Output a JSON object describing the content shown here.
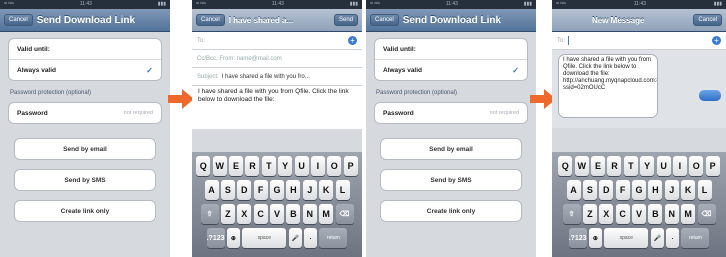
{
  "colors": {
    "accent": "#3a7bd5",
    "arrow": "#ef6a2a",
    "nav": "#5c7ea6"
  },
  "status": {
    "carrier": "ᵃᵗ ᵗᵉˡᵉ",
    "time": "11:43",
    "battery": "▮▮▮"
  },
  "screen1": {
    "nav_btn": "Cancel",
    "title": "Send Download Link",
    "rows": [
      {
        "label": "Valid until:"
      },
      {
        "label": "Always valid"
      }
    ],
    "section": "Password protection (optional)",
    "password": {
      "label": "Password",
      "placeholder": "not required"
    },
    "buttons": [
      "Send by email",
      "Send by SMS",
      "Create link only"
    ]
  },
  "screen2": {
    "nav_btn": "Cancel",
    "title": "I have shared a...",
    "nav_right": "Send",
    "to": "To:",
    "cc": "Cc/Bcc, From: name@mail.com",
    "subject_label": "Subject:",
    "subject": "I have shared a file with you fro...",
    "body": "I have shared a file with you from Qfile. Click the link below to download the file:"
  },
  "screen3": {
    "nav_btn": "Cancel",
    "title": "Send Download Link",
    "rows": [
      {
        "label": "Valid until:"
      },
      {
        "label": "Always valid"
      }
    ],
    "section": "Password protection (optional)",
    "password": {
      "label": "Password",
      "placeholder": "not required"
    },
    "buttons": [
      "Send by email",
      "Send by SMS",
      "Create link only"
    ]
  },
  "screen4": {
    "title": "New Message",
    "nav_right": "Cancel",
    "to": "To:",
    "message": "I have shared a file with you from Qfile. Click the link below to download the file: http://anchuang.myqnapcloud.com:8080/share.cgi?ssid=02mOUcC"
  },
  "keyboard": {
    "row1": [
      "Q",
      "W",
      "E",
      "R",
      "T",
      "Y",
      "U",
      "I",
      "O",
      "P"
    ],
    "row2": [
      "A",
      "S",
      "D",
      "F",
      "G",
      "H",
      "J",
      "K",
      "L"
    ],
    "row3": [
      "Z",
      "X",
      "C",
      "V",
      "B",
      "N",
      "M"
    ],
    "shift": "⇧",
    "delete": "⌫",
    "num": ".?123",
    "globe": "⊕",
    "space": "space",
    "mic": "🎤",
    "dot": ".",
    "return": "return"
  }
}
